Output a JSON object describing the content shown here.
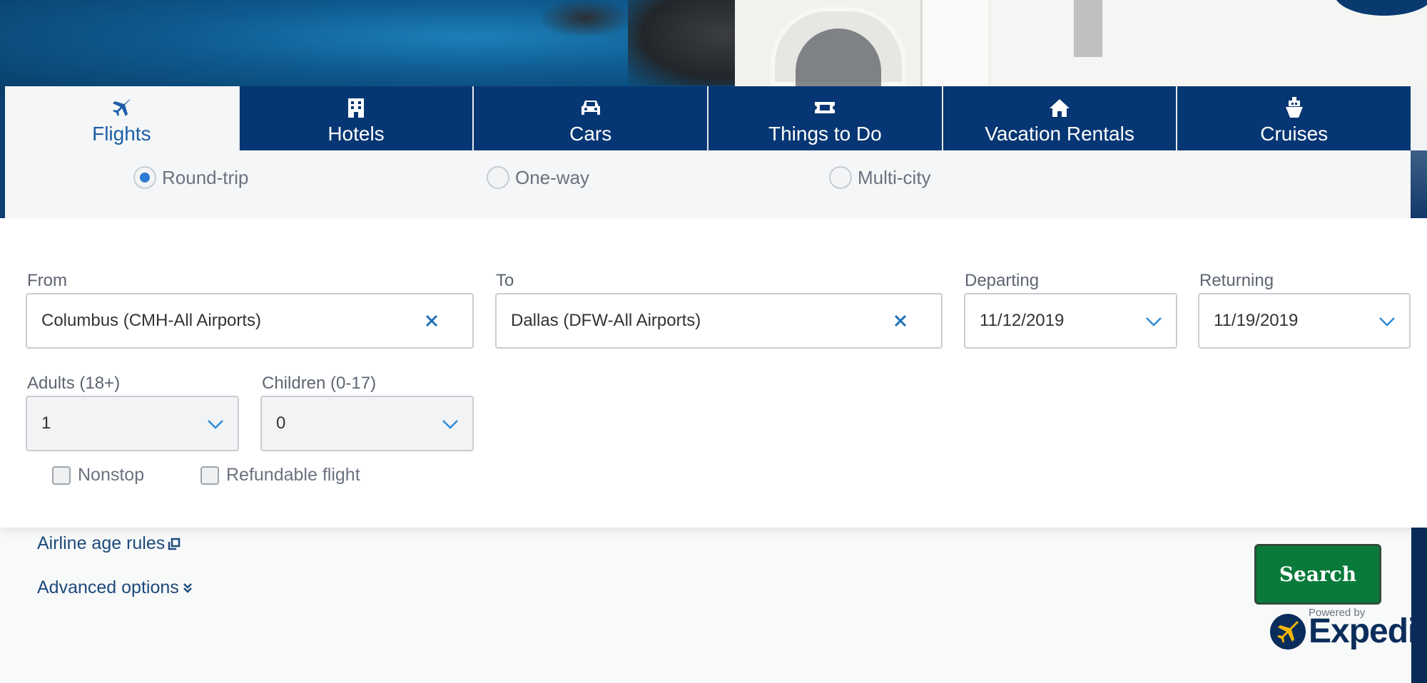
{
  "tabs": [
    {
      "label": "Flights",
      "icon": "plane-icon",
      "active": true
    },
    {
      "label": "Hotels",
      "icon": "building-icon",
      "active": false
    },
    {
      "label": "Cars",
      "icon": "car-icon",
      "active": false
    },
    {
      "label": "Things to Do",
      "icon": "ticket-icon",
      "active": false
    },
    {
      "label": "Vacation Rentals",
      "icon": "house-icon",
      "active": false
    },
    {
      "label": "Cruises",
      "icon": "ship-icon",
      "active": false
    }
  ],
  "trip_type": {
    "options": [
      "Round-trip",
      "One-way",
      "Multi-city"
    ],
    "selected": "Round-trip"
  },
  "form": {
    "from_label": "From",
    "from_value": "Columbus (CMH-All Airports)",
    "to_label": "To",
    "to_value": "Dallas (DFW-All Airports)",
    "departing_label": "Departing",
    "departing_value": "11/12/2019",
    "returning_label": "Returning",
    "returning_value": "11/19/2019",
    "adults_label": "Adults (18+)",
    "adults_value": "1",
    "children_label": "Children (0-17)",
    "children_value": "0",
    "nonstop_label": "Nonstop",
    "refundable_label": "Refundable flight"
  },
  "links": {
    "airline_age_rules": "Airline age rules",
    "advanced_options": "Advanced options"
  },
  "search_label": "Search",
  "powered_by": "Powered by",
  "brand": "Expedia",
  "colors": {
    "tab_bg": "#063673",
    "tab_active_text": "#1b5ea6",
    "search_button": "#0a7a3b",
    "link": "#1d4a7c"
  }
}
